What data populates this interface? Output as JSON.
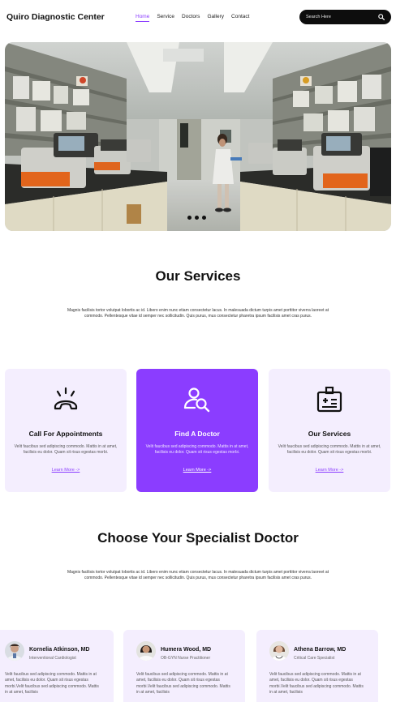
{
  "header": {
    "brand": "Quiro Diagnostic Center",
    "nav": [
      "Home",
      "Service",
      "Doctors",
      "Gallery",
      "Contact"
    ],
    "active_nav": "Home",
    "search_placeholder": "Search Here"
  },
  "hero": {
    "image": "laboratory-photo",
    "slide_count": 3
  },
  "services": {
    "title": "Our Services",
    "description": "Magnis facilisis tortor volutpat lobortis ac id. Libero enim nunc etiam consectetur lacus. In malesuada dictum turpis amet porttitor viverra laoreet at commodo. Pellentesque vitae id semper nec sollicitudin. Quis purus, mus consectetur pharetra ipsum facilisis amet cras purus.",
    "cards": [
      {
        "icon": "phone-call-icon",
        "title": "Call For Appointments",
        "text": "Velit faucibus sed adipiscing commodo. Mattis in at amet, facilisis eu dolor. Quam sit risus egestas morbi.",
        "link": "Learn More ->",
        "active": false
      },
      {
        "icon": "find-doctor-icon",
        "title": "Find A Doctor",
        "text": "Velit faucibus sed adipiscing commodo. Mattis in at amet, facilisis eu dolor. Quam sit risus egestas morbi.",
        "link": "Learn More ->",
        "active": true
      },
      {
        "icon": "medical-id-icon",
        "title": "Our Services",
        "text": "Velit faucibus sed adipiscing commodo. Mattis in at amet, facilisis eu dolor. Quam sit risus egestas morbi.",
        "link": "Learn More ->",
        "active": false
      }
    ]
  },
  "specialists": {
    "title": "Choose Your Specialist Doctor",
    "description": "Magnis facilisis tortor volutpat lobortis ac id. Libero enim nunc etiam consectetur lacus. In malesuada dictum turpis amet porttitor viverra laoreet at commodo. Pellentesque vitae id semper nec sollicitudin. Quis purus, mus consectetur pharetra ipsum facilisis amet cras purus.",
    "doctors": [
      {
        "name": "Kornelia Atkinson, MD",
        "role": "Interventional Cardiologist",
        "text": "Velit faucibus sed adipiscing commodo. Mattis in at amet, facilisis eu dolor. Quam sit risus egestas morbi.Velit faucibus sed adipiscing commodo. Mattis in at amet, facilisis"
      },
      {
        "name": "Humera Wood, MD",
        "role": "OB-GYN Nurse Practitioner",
        "text": "Velit faucibus sed adipiscing commodo. Mattis in at amet, facilisis eu dolor. Quam sit risus egestas morbi.Velit faucibus sed adipiscing commodo. Mattis in at amet, facilisis"
      },
      {
        "name": "Athena Barrow, MD",
        "role": "Critical Care Specialist",
        "text": "Velit faucibus sed adipiscing commodo. Mattis in at amet, facilisis eu dolor. Quam sit risus egestas morbi.Velit faucibus sed adipiscing commodo. Mattis in at amet, facilisis"
      }
    ]
  },
  "colors": {
    "accent": "#8b3dff",
    "card_bg": "#f4eefe",
    "search_bg": "#0d0d0d"
  }
}
